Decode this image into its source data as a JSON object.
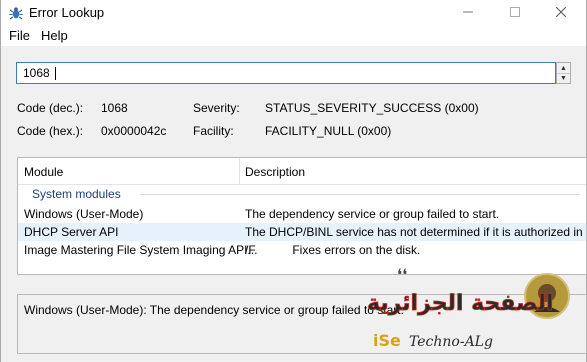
{
  "window": {
    "title": "Error Lookup",
    "app_icon": "bug-icon",
    "controls": [
      "minimize-icon",
      "maximize-icon",
      "close-icon"
    ]
  },
  "menu": {
    "file": "File",
    "help": "Help"
  },
  "lookup": {
    "value": "1068"
  },
  "code_info": {
    "dec_label": "Code (dec.):",
    "dec_value": "1068",
    "hex_label": "Code (hex.):",
    "hex_value": "0x0000042c",
    "severity_label": "Severity:",
    "severity_value": "STATUS_SEVERITY_SUCCESS (0x00)",
    "facility_label": "Facility:",
    "facility_value": "FACILITY_NULL (0x00)"
  },
  "table": {
    "columns": {
      "module": "Module",
      "description": "Description"
    },
    "group": "System modules",
    "rows": [
      {
        "module": "Windows (User-Mode)",
        "description": "The dependency service or group failed to start."
      },
      {
        "module": "DHCP Server API",
        "description": "The DHCP/BINL service has not determined if it is authorized in ..."
      },
      {
        "module": "Image Mastering File System Imaging API...",
        "description": "/F           Fixes errors on the disk."
      }
    ]
  },
  "status": {
    "text": "Windows (User-Mode): The dependency service or group failed to start."
  },
  "watermark": {
    "line1": "الصفحة الجزائرية",
    "line2": "Techno-ALg"
  },
  "colors": {
    "input_border": "#3c7fb1",
    "group_text": "#1e3f7a",
    "selected_row": "#e5f1fb"
  }
}
